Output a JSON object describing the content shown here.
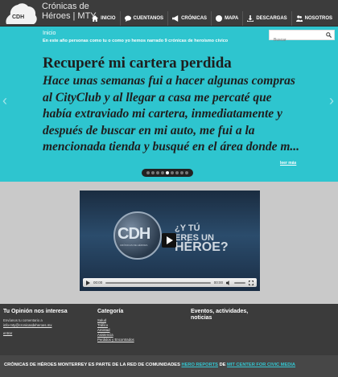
{
  "header": {
    "title_line1": "Crónicas de",
    "title_line2": "Héroes | MTY",
    "logo_text": "CDH"
  },
  "nav": [
    {
      "label": "INICIO",
      "icon": "home-icon"
    },
    {
      "label": "CUENTANOS",
      "icon": "speech-bubble-icon"
    },
    {
      "label": "CRÓNICAS",
      "icon": "megaphone-icon"
    },
    {
      "label": "MAPA",
      "icon": "globe-icon"
    },
    {
      "label": "DESCARGAS",
      "icon": "download-icon"
    },
    {
      "label": "NOSOTROS",
      "icon": "people-icon"
    }
  ],
  "hero": {
    "breadcrumb": "Inicio",
    "tagline": "En este año personas como tu o como yo hemos narrado 9 crónicas de heroísmo cívico",
    "search_placeholder": "Buscar",
    "slide_title": "Recuperé mi cartera perdida",
    "slide_body": "Hace unas semanas fui a hacer algunas compras al CityClub y al llegar a casa me percaté que había extraviado mi cartera, inmediatamente y después de buscar en mi auto, me fui a la mencionada tienda y busqué en el área donde m...",
    "read_more": "leer más",
    "prev_arrow": "‹",
    "next_arrow": "›",
    "active_slide": 5,
    "slide_count": 9
  },
  "video": {
    "cdh_text": "CDH",
    "cdh_sub": "CRÓNICAS DE HÉROES",
    "question_line1": "¿Y TÚ",
    "question_line2": "ERES UN",
    "question_line3": "HÉROE?",
    "time_current": "00:00",
    "time_total": "00:00"
  },
  "footer": {
    "col1": {
      "heading": "Tu Opinión nos interesa",
      "text": "Envíanos tu comentario a",
      "email": "info-mty@cronicasdeheroes.mx",
      "link": "entrar"
    },
    "col2": {
      "heading": "Categoría",
      "items": [
        "Salud",
        "Tráfico",
        "Amistad",
        "Asistencia",
        "Perdidos y Encontrados"
      ]
    },
    "col3": {
      "heading": "Eventos, actividades, noticias"
    }
  },
  "bottom": {
    "text_before": "CRÓNICAS DE HÉROES MONTERREY ES PARTE DE LA RED DE COMUNIDADES ",
    "link1": "HERO REPORTS",
    "text_mid": " DE ",
    "link2": "MIT CENTER FOR CIVIC MEDIA"
  },
  "colors": {
    "accent": "#2ec5cf",
    "header_bg": "#3c3c3c",
    "band_bg": "#c9c9c9"
  }
}
